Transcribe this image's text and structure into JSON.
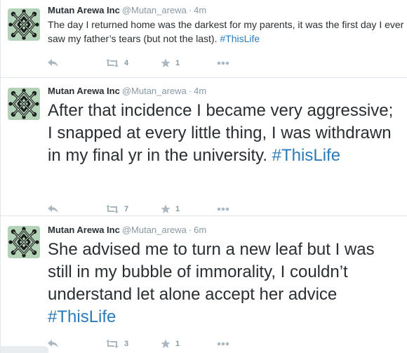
{
  "colors": {
    "hashtag": "#2b7bb9",
    "name": "#292f33",
    "muted": "#8899a6",
    "action_icon": "#aab8c2",
    "avatar_bg": "#b3d2b7",
    "avatar_knot": "#1a1a1a"
  },
  "tweets": [
    {
      "author": {
        "name": "Mutan Arewa Inc",
        "handle": "@Mutan_arewa",
        "avatar_icon": "arewa-knot-logo"
      },
      "separator": "·",
      "time": "4m",
      "text": "The day I returned home was the darkest for my parents, it was the first day I ever saw my father’s tears (but not the last).",
      "hashtag": "#ThisLife",
      "actions": {
        "reply_icon": "reply-icon",
        "retweet_icon": "retweet-icon",
        "retweet_count": "4",
        "favorite_icon": "star-icon",
        "favorite_count": "1",
        "more_icon": "more-dots-icon"
      }
    },
    {
      "author": {
        "name": "Mutan Arewa Inc",
        "handle": "@Mutan_arewa",
        "avatar_icon": "arewa-knot-logo"
      },
      "separator": "·",
      "time": "4m",
      "text": "After that incidence I became very aggressive; I snapped at every little thing, I was withdrawn in my final yr in the university.",
      "hashtag": "#ThisLife",
      "actions": {
        "reply_icon": "reply-icon",
        "retweet_icon": "retweet-icon",
        "retweet_count": "7",
        "favorite_icon": "star-icon",
        "favorite_count": "1",
        "more_icon": "more-dots-icon"
      }
    },
    {
      "author": {
        "name": "Mutan Arewa Inc",
        "handle": "@Mutan_arewa",
        "avatar_icon": "arewa-knot-logo"
      },
      "separator": "·",
      "time": "6m",
      "text": "She advised me to turn a new leaf but I was still in my bubble of immorality, I couldn’t understand let alone accept her advice",
      "hashtag": "#ThisLife",
      "actions": {
        "reply_icon": "reply-icon",
        "retweet_icon": "retweet-icon",
        "retweet_count": "3",
        "favorite_icon": "star-icon",
        "favorite_count": "1",
        "more_icon": "more-dots-icon"
      }
    }
  ]
}
